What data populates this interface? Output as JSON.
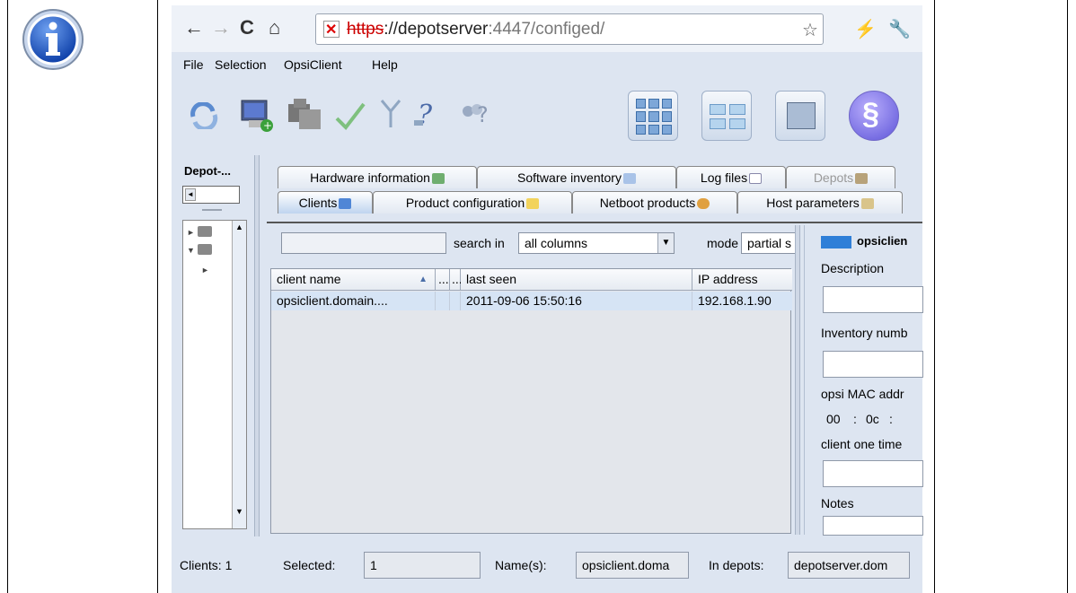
{
  "browser": {
    "back": "←",
    "forward": "→",
    "reload": "C",
    "home": "⌂",
    "url_scheme": "https",
    "url_host": "://depotserver",
    "url_port": ":4447",
    "url_path": "/configed/",
    "star": "☆",
    "bolt": "⚡",
    "wrench": "🔧"
  },
  "menu": [
    "File",
    "Selection",
    "OpsiClient",
    "Help"
  ],
  "depot": {
    "label": "Depot-..."
  },
  "tabs_top": [
    {
      "label": "Hardware information",
      "icon": "hardware-icon"
    },
    {
      "label": "Software inventory",
      "icon": "software-icon"
    },
    {
      "label": "Log files",
      "icon": "log-icon"
    },
    {
      "label": "Depots",
      "icon": "depots-icon"
    }
  ],
  "tabs_bottom": [
    {
      "label": "Clients",
      "icon": "monitor-icon"
    },
    {
      "label": "Product configuration",
      "icon": "package-icon"
    },
    {
      "label": "Netboot products",
      "icon": "linux-icon"
    },
    {
      "label": "Host parameters",
      "icon": "params-icon"
    }
  ],
  "search": {
    "search_in_label": "search in",
    "search_in_value": "all columns",
    "mode_label": "mode",
    "mode_value": "partial s"
  },
  "table": {
    "columns": [
      "client name",
      "...",
      "...",
      "last seen",
      "IP address"
    ],
    "sort_arrow": "▲",
    "rows": [
      [
        "opsiclient.domain....",
        "",
        "",
        "2011-09-06 15:50:16",
        "192.168.1.90"
      ]
    ]
  },
  "details": {
    "host": "opsiclien",
    "description_label": "Description",
    "inventory_label": "Inventory numb",
    "mac_label": "opsi MAC addr",
    "mac_part1": "00",
    "mac_part2": "0c",
    "onetime_label": "client one time",
    "notes_label": "Notes"
  },
  "status": {
    "clients": "Clients: 1",
    "selected_label": "Selected:",
    "selected_value": "1",
    "names_label": "Name(s):",
    "names_value": "opsiclient.doma",
    "depots_label": "In depots:",
    "depots_value": "depotserver.dom"
  }
}
